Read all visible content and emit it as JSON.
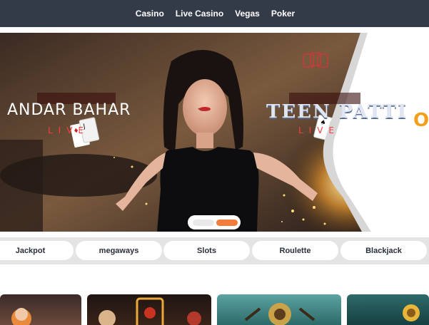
{
  "nav": {
    "items": [
      {
        "label": "Casino"
      },
      {
        "label": "Live Casino"
      },
      {
        "label": "Vegas"
      },
      {
        "label": "Poker"
      }
    ]
  },
  "banner": {
    "left_title": "ANDAR BAHAR",
    "left_subtitle": "LIVE",
    "right_title": "TEEN PATTI",
    "right_subtitle": "LIVE",
    "edge_letter": "O",
    "slides_total": 2,
    "active_slide": 2
  },
  "categories": [
    {
      "label": "Jackpot"
    },
    {
      "label": "megaways"
    },
    {
      "label": "Slots"
    },
    {
      "label": "Roulette"
    },
    {
      "label": "Blackjack"
    }
  ],
  "colors": {
    "nav_bg": "#343b48",
    "accent": "#f27c3b",
    "category_bar": "#e4e4e4"
  }
}
